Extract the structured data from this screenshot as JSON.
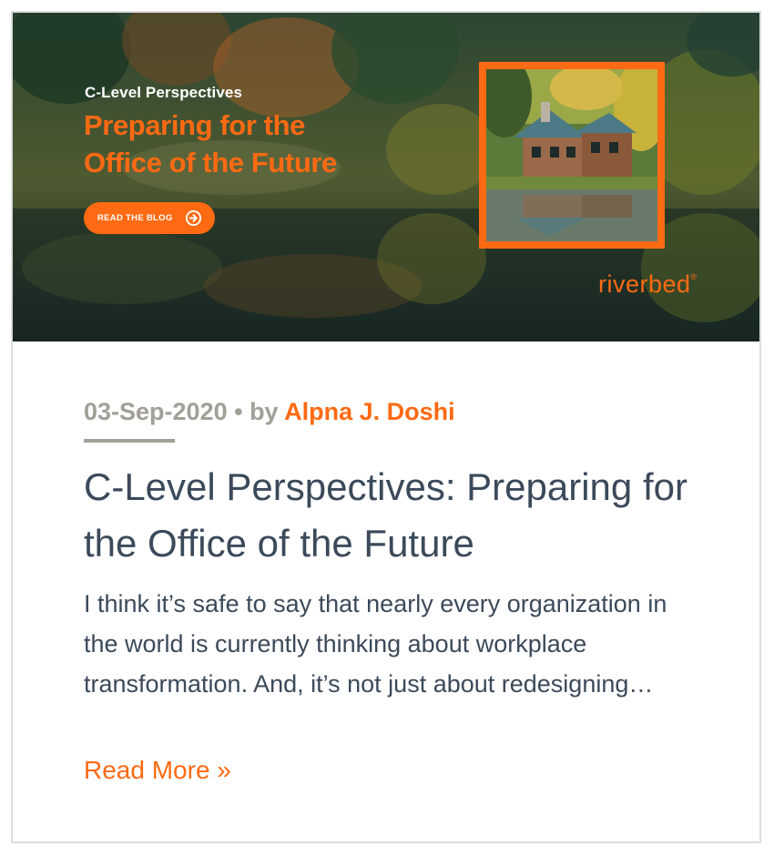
{
  "hero": {
    "kicker": "C-Level Perspectives",
    "title_line1": "Preparing for the",
    "title_line2": "Office of the Future",
    "button_label": "READ THE BLOG",
    "brand": "riverbed",
    "brand_mark": "®",
    "icons": [
      "arrow-right-circle-icon"
    ]
  },
  "post": {
    "date": "03-Sep-2020",
    "by": " • by ",
    "author": "Alpna J. Doshi",
    "title": "C-Level Perspectives: Preparing for the Office of the Future",
    "excerpt": "I think it’s safe to say that nearly every organization in the world is currently thinking about workplace transformation. And, it’s not just about redesigning…",
    "read_more": "Read More »"
  },
  "colors": {
    "accent": "#ff6a13",
    "meta_gray": "#a19f97",
    "text": "#3b4a5a",
    "border": "#dcdcdc"
  }
}
